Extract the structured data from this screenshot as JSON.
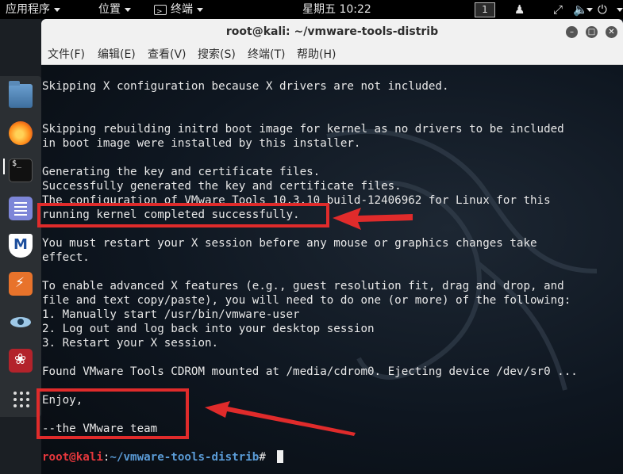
{
  "topbar": {
    "apps_label": "应用程序",
    "places_label": "位置",
    "terminal_label": "终端",
    "clock": "星期五 10:22",
    "workspace": "1"
  },
  "dock": {
    "items": [
      "files",
      "firefox",
      "terminal",
      "text-editor",
      "metasploit",
      "burpsuite",
      "eye",
      "cherrytree",
      "show-apps"
    ]
  },
  "window": {
    "title": "root@kali: ~/vmware-tools-distrib",
    "menu": [
      "文件(F)",
      "编辑(E)",
      "查看(V)",
      "搜索(S)",
      "终端(T)",
      "帮助(H)"
    ]
  },
  "terminal": {
    "lines": [
      "Skipping X configuration because X drivers are not included.",
      "",
      "",
      "Skipping rebuilding initrd boot image for kernel as no drivers to be included",
      "in boot image were installed by this installer.",
      "",
      "Generating the key and certificate files.",
      "Successfully generated the key and certificate files.",
      "The configuration of VMware Tools 10.3.10 build-12406962 for Linux for this",
      "running kernel completed successfully.",
      "",
      "You must restart your X session before any mouse or graphics changes take",
      "effect.",
      "",
      "To enable advanced X features (e.g., guest resolution fit, drag and drop, and",
      "file and text copy/paste), you will need to do one (or more) of the following:",
      "1. Manually start /usr/bin/vmware-user",
      "2. Log out and log back into your desktop session",
      "3. Restart your X session.",
      "",
      "Found VMware Tools CDROM mounted at /media/cdrom0. Ejecting device /dev/sr0 ...",
      "",
      "Enjoy,",
      "",
      "--the VMware team"
    ],
    "prompt_user": "root@kali",
    "prompt_sep": ":",
    "prompt_path": "~/vmware-tools-distrib",
    "prompt_symbol": "# "
  },
  "colors": {
    "annotation": "#e02b2b",
    "prompt_user": "#e6373c",
    "prompt_path": "#5a9bd6"
  }
}
